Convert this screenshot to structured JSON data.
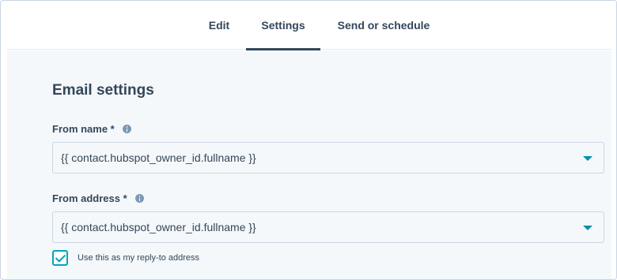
{
  "tabs": {
    "edit": "Edit",
    "settings": "Settings",
    "send": "Send or schedule"
  },
  "section": {
    "title": "Email settings"
  },
  "from_name": {
    "label": "From name *",
    "value": "{{ contact.hubspot_owner_id.fullname }}"
  },
  "from_address": {
    "label": "From address *",
    "value": "{{ contact.hubspot_owner_id.fullname }}"
  },
  "reply_to": {
    "label": "Use this as my reply-to address",
    "checked": true
  },
  "colors": {
    "text": "#33475b",
    "accent": "#00a4bd",
    "caret": "#0091ae",
    "background": "#f5f8fa",
    "border": "#cbd6e2"
  }
}
